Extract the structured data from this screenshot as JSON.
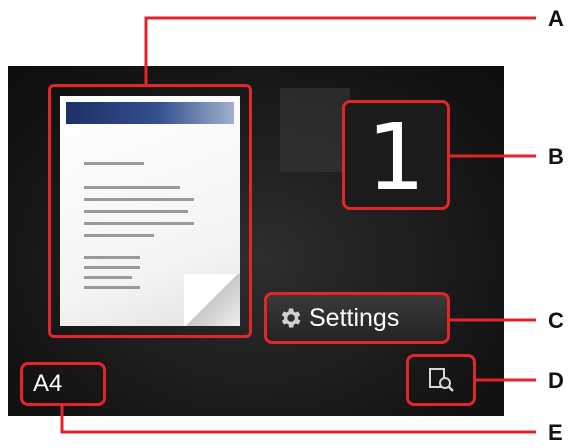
{
  "screen": {
    "page_count": "1",
    "settings_label": "Settings",
    "settings_icon": "gear-icon",
    "paper_size": "A4",
    "preview_icon": "preview-magnifier-icon"
  },
  "callouts": {
    "a": "A",
    "b": "B",
    "c": "C",
    "d": "D",
    "e": "E"
  },
  "colors": {
    "callout": "#e0262b",
    "screen_bg": "#1a1a1a",
    "text": "#ffffff"
  }
}
